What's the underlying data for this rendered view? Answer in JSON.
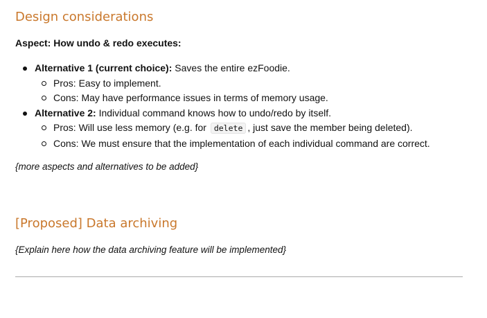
{
  "design_considerations": {
    "heading": "Design considerations",
    "aspect_label": "Aspect: How undo & redo executes:",
    "alternatives": [
      {
        "label": "Alternative 1 (current choice):",
        "description": " Saves the entire ezFoodie.",
        "pros": "Pros: Easy to implement.",
        "cons": "Cons: May have performance issues in terms of memory usage."
      },
      {
        "label": "Alternative 2:",
        "description": " Individual command knows how to undo/redo by itself.",
        "pros_before": "Pros: Will use less memory (e.g. for ",
        "pros_code": "delete",
        "pros_after": ", just save the member being deleted).",
        "cons": "Cons: We must ensure that the implementation of each individual command are correct."
      }
    ],
    "more_note": "{more aspects and alternatives to be added}"
  },
  "data_archiving": {
    "heading": "[Proposed] Data archiving",
    "note": "{Explain here how the data archiving feature will be implemented}"
  }
}
